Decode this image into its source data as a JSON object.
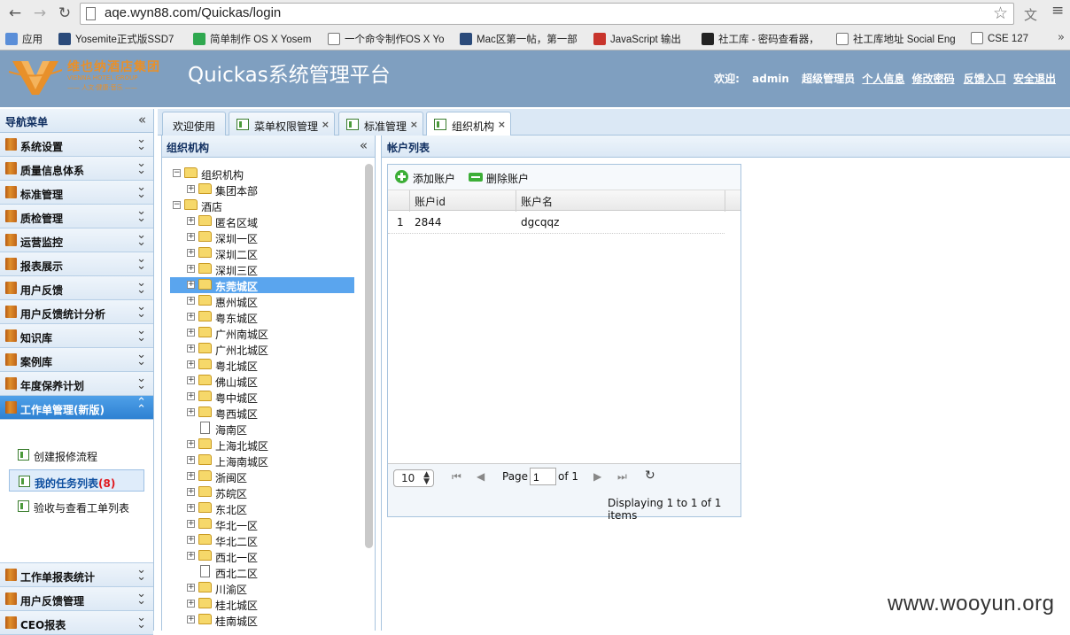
{
  "browser": {
    "url": "aqe.wyn88.com/Quickas/login",
    "bookmarks": [
      {
        "label": "应用",
        "color": "#5a8ed8"
      },
      {
        "label": "Yosemite正式版SSD7",
        "color": "#2a4a7a"
      },
      {
        "label": "简单制作 OS X Yosem",
        "color": "#2fa84f"
      },
      {
        "label": "一个命令制作OS X Yo",
        "color": "#ffffff"
      },
      {
        "label": "Mac区第一帖，第一部",
        "color": "#2a4a7a"
      },
      {
        "label": "JavaScript 输出",
        "color": "#c8342c"
      },
      {
        "label": "社工库 - 密码查看器，",
        "color": "#222222"
      },
      {
        "label": "社工库地址 Social Eng",
        "color": "#ffffff"
      },
      {
        "label": "CSE 127",
        "color": "#ffffff"
      }
    ],
    "bookmark_icons": [
      "apps-icon",
      "page-icon",
      "check-icon",
      "document-icon",
      "page-icon",
      "w3-icon",
      "pw-icon",
      "document-icon",
      "document-icon"
    ]
  },
  "header": {
    "logo_brand": "维也纳酒店集团",
    "logo_sub1": "VIENNA HOTEL GROUP",
    "logo_sub2": "—— 人文·健康·音乐 ——",
    "app_title": "Quickas系统管理平台",
    "welcome": "欢迎:",
    "user": "admin",
    "role": "超级管理员",
    "links": [
      "个人信息",
      "修改密码",
      "反馈入口",
      "安全退出"
    ]
  },
  "nav": {
    "title": "导航菜单",
    "collapse": "«",
    "sections": [
      "系统设置",
      "质量信息体系",
      "标准管理",
      "质检管理",
      "运营监控",
      "报表展示",
      "用户反馈",
      "用户反馈统计分析",
      "知识库",
      "案例库",
      "年度保养计划"
    ],
    "active_section": "工作单管理(新版)",
    "sub_items": [
      {
        "label": "创建报修流程",
        "badge": ""
      },
      {
        "label": "我的任务列表",
        "badge": "(8)"
      },
      {
        "label": "验收与查看工单列表",
        "badge": ""
      }
    ],
    "bottom_sections": [
      "工作单报表统计",
      "用户反馈管理",
      "CEO报表"
    ]
  },
  "tabs": [
    {
      "label": "欢迎使用",
      "icon": false,
      "close": false
    },
    {
      "label": "菜单权限管理",
      "icon": true,
      "close": true
    },
    {
      "label": "标准管理",
      "icon": true,
      "close": true
    },
    {
      "label": "组织机构",
      "icon": true,
      "close": true,
      "active": true
    }
  ],
  "tree": {
    "title": "组织机构",
    "collapse": "«",
    "nodes": [
      {
        "label": "组织机构",
        "level": 0,
        "pm": "−",
        "type": "folder"
      },
      {
        "label": "集团本部",
        "level": 1,
        "pm": "+",
        "type": "folder"
      },
      {
        "label": "酒店",
        "level": 0,
        "pm": "−",
        "type": "folder"
      },
      {
        "label": "匿名区域",
        "level": 1,
        "pm": "+",
        "type": "folder"
      },
      {
        "label": "深圳一区",
        "level": 1,
        "pm": "+",
        "type": "folder"
      },
      {
        "label": "深圳二区",
        "level": 1,
        "pm": "+",
        "type": "folder"
      },
      {
        "label": "深圳三区",
        "level": 1,
        "pm": "+",
        "type": "folder"
      },
      {
        "label": "东莞城区",
        "level": 1,
        "pm": "+",
        "type": "folder",
        "selected": true
      },
      {
        "label": "惠州城区",
        "level": 1,
        "pm": "+",
        "type": "folder"
      },
      {
        "label": "粤东城区",
        "level": 1,
        "pm": "+",
        "type": "folder"
      },
      {
        "label": "广州南城区",
        "level": 1,
        "pm": "+",
        "type": "folder"
      },
      {
        "label": "广州北城区",
        "level": 1,
        "pm": "+",
        "type": "folder"
      },
      {
        "label": "粤北城区",
        "level": 1,
        "pm": "+",
        "type": "folder"
      },
      {
        "label": "佛山城区",
        "level": 1,
        "pm": "+",
        "type": "folder"
      },
      {
        "label": "粤中城区",
        "level": 1,
        "pm": "+",
        "type": "folder"
      },
      {
        "label": "粤西城区",
        "level": 1,
        "pm": "+",
        "type": "folder"
      },
      {
        "label": "海南区",
        "level": 1,
        "pm": "",
        "type": "file"
      },
      {
        "label": "上海北城区",
        "level": 1,
        "pm": "+",
        "type": "folder"
      },
      {
        "label": "上海南城区",
        "level": 1,
        "pm": "+",
        "type": "folder"
      },
      {
        "label": "浙闽区",
        "level": 1,
        "pm": "+",
        "type": "folder"
      },
      {
        "label": "苏皖区",
        "level": 1,
        "pm": "+",
        "type": "folder"
      },
      {
        "label": "东北区",
        "level": 1,
        "pm": "+",
        "type": "folder"
      },
      {
        "label": "华北一区",
        "level": 1,
        "pm": "+",
        "type": "folder"
      },
      {
        "label": "华北二区",
        "level": 1,
        "pm": "+",
        "type": "folder"
      },
      {
        "label": "西北一区",
        "level": 1,
        "pm": "+",
        "type": "folder"
      },
      {
        "label": "西北二区",
        "level": 1,
        "pm": "",
        "type": "file"
      },
      {
        "label": "川渝区",
        "level": 1,
        "pm": "+",
        "type": "folder"
      },
      {
        "label": "桂北城区",
        "level": 1,
        "pm": "+",
        "type": "folder"
      },
      {
        "label": "桂南城区",
        "level": 1,
        "pm": "+",
        "type": "folder"
      }
    ]
  },
  "accounts": {
    "title": "帐户列表",
    "add_label": "添加账户",
    "delete_label": "删除账户",
    "columns": [
      "账户id",
      "账户名"
    ],
    "rows": [
      {
        "num": "1",
        "id": "2844",
        "name": "dgcqqz"
      }
    ],
    "pager": {
      "page_size": "10",
      "page_label": "Page",
      "page_value": "1",
      "of_label": "of 1",
      "display": "Displaying 1 to 1 of 1 items"
    }
  },
  "watermark": "www.wooyun.org"
}
